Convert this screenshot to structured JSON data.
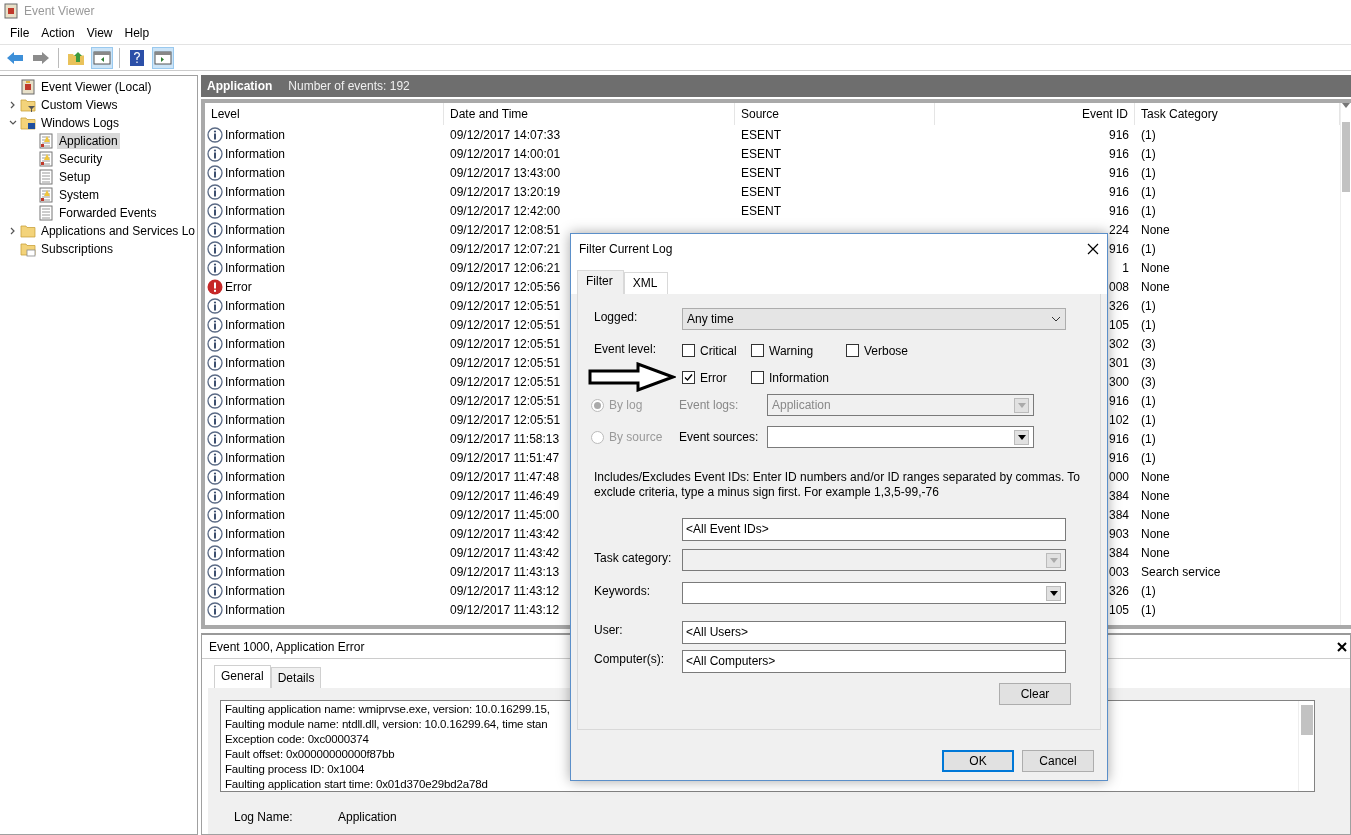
{
  "window": {
    "title": "Event Viewer"
  },
  "menu": [
    "File",
    "Action",
    "View",
    "Help"
  ],
  "tree": [
    {
      "label": "Event Viewer (Local)",
      "kind": "root"
    },
    {
      "label": "Custom Views",
      "kind": "filter-folder",
      "expanded": false
    },
    {
      "label": "Windows Logs",
      "kind": "log-folder",
      "expanded": true,
      "children": [
        {
          "label": "Application",
          "kind": "log",
          "selected": true
        },
        {
          "label": "Security",
          "kind": "log",
          "selected": false
        },
        {
          "label": "Setup",
          "kind": "plain-log",
          "selected": false
        },
        {
          "label": "System",
          "kind": "log",
          "selected": false
        },
        {
          "label": "Forwarded Events",
          "kind": "plain-log",
          "selected": false
        }
      ]
    },
    {
      "label": "Applications and Services Lo",
      "kind": "folder",
      "expanded": false
    },
    {
      "label": "Subscriptions",
      "kind": "subscriptions"
    }
  ],
  "log_pane": {
    "title": "Application",
    "count": "Number of events: 192",
    "columns": [
      "Level",
      "Date and Time",
      "Source",
      "Event ID",
      "Task Category"
    ],
    "rows": [
      {
        "kind": "information",
        "level": "Information",
        "date": "09/12/2017 14:07:33",
        "source": "ESENT",
        "event_id": "916",
        "task_category": "(1)"
      },
      {
        "kind": "information",
        "level": "Information",
        "date": "09/12/2017 14:00:01",
        "source": "ESENT",
        "event_id": "916",
        "task_category": "(1)"
      },
      {
        "kind": "information",
        "level": "Information",
        "date": "09/12/2017 13:43:00",
        "source": "ESENT",
        "event_id": "916",
        "task_category": "(1)"
      },
      {
        "kind": "information",
        "level": "Information",
        "date": "09/12/2017 13:20:19",
        "source": "ESENT",
        "event_id": "916",
        "task_category": "(1)"
      },
      {
        "kind": "information",
        "level": "Information",
        "date": "09/12/2017 12:42:00",
        "source": "ESENT",
        "event_id": "916",
        "task_category": "(1)"
      },
      {
        "kind": "information",
        "level": "Information",
        "date": "09/12/2017 12:08:51",
        "event_id": "224",
        "task_category": "None"
      },
      {
        "kind": "information",
        "level": "Information",
        "date": "09/12/2017 12:07:21",
        "event_id": "916",
        "task_category": "(1)"
      },
      {
        "kind": "information",
        "level": "Information",
        "date": "09/12/2017 12:06:21",
        "event_id": "1",
        "task_category": "None"
      },
      {
        "kind": "error",
        "level": "Error",
        "date": "09/12/2017 12:05:56",
        "event_id": "008",
        "task_category": "None"
      },
      {
        "kind": "information",
        "level": "Information",
        "date": "09/12/2017 12:05:51",
        "event_id": "326",
        "task_category": "(1)"
      },
      {
        "kind": "information",
        "level": "Information",
        "date": "09/12/2017 12:05:51",
        "event_id": "105",
        "task_category": "(1)"
      },
      {
        "kind": "information",
        "level": "Information",
        "date": "09/12/2017 12:05:51",
        "event_id": "302",
        "task_category": "(3)"
      },
      {
        "kind": "information",
        "level": "Information",
        "date": "09/12/2017 12:05:51",
        "event_id": "301",
        "task_category": "(3)"
      },
      {
        "kind": "information",
        "level": "Information",
        "date": "09/12/2017 12:05:51",
        "event_id": "300",
        "task_category": "(3)"
      },
      {
        "kind": "information",
        "level": "Information",
        "date": "09/12/2017 12:05:51",
        "event_id": "916",
        "task_category": "(1)"
      },
      {
        "kind": "information",
        "level": "Information",
        "date": "09/12/2017 12:05:51",
        "event_id": "102",
        "task_category": "(1)"
      },
      {
        "kind": "information",
        "level": "Information",
        "date": "09/12/2017 11:58:13",
        "event_id": "916",
        "task_category": "(1)"
      },
      {
        "kind": "information",
        "level": "Information",
        "date": "09/12/2017 11:51:47",
        "event_id": "916",
        "task_category": "(1)"
      },
      {
        "kind": "information",
        "level": "Information",
        "date": "09/12/2017 11:47:48",
        "event_id": "000",
        "task_category": "None"
      },
      {
        "kind": "information",
        "level": "Information",
        "date": "09/12/2017 11:46:49",
        "event_id": "384",
        "task_category": "None"
      },
      {
        "kind": "information",
        "level": "Information",
        "date": "09/12/2017 11:45:00",
        "event_id": "384",
        "task_category": "None"
      },
      {
        "kind": "information",
        "level": "Information",
        "date": "09/12/2017 11:43:42",
        "event_id": "903",
        "task_category": "None"
      },
      {
        "kind": "information",
        "level": "Information",
        "date": "09/12/2017 11:43:42",
        "event_id": "384",
        "task_category": "None"
      },
      {
        "kind": "information",
        "level": "Information",
        "date": "09/12/2017 11:43:13",
        "event_id": "003",
        "task_category": "Search service"
      },
      {
        "kind": "information",
        "level": "Information",
        "date": "09/12/2017 11:43:12",
        "event_id": "326",
        "task_category": "(1)"
      },
      {
        "kind": "information",
        "level": "Information",
        "date": "09/12/2017 11:43:12",
        "event_id": "105",
        "task_category": "(1)"
      }
    ]
  },
  "details": {
    "title": "Event 1000, Application Error",
    "tabs": [
      {
        "label": "General",
        "selected": true
      },
      {
        "label": "Details",
        "selected": false
      }
    ],
    "description": [
      "Faulting application name: wmiprvse.exe, version: 10.0.16299.15,",
      "Faulting module name: ntdll.dll, version: 10.0.16299.64, time stan",
      "Exception code: 0xc0000374",
      "Fault offset: 0x00000000000f87bb",
      "Faulting process ID: 0x1004",
      "Faulting application start time: 0x01d370e29bd2a78d"
    ],
    "fields": [
      {
        "label": "Log Name:",
        "value": "Application"
      }
    ]
  },
  "dialog": {
    "title": "Filter Current Log",
    "tabs": [
      {
        "label": "Filter",
        "selected": true
      },
      {
        "label": "XML",
        "selected": false
      }
    ],
    "logged": {
      "label": "Logged:",
      "value": "Any time"
    },
    "event_level": {
      "label": "Event level:",
      "options": [
        {
          "label": "Critical",
          "checked": false
        },
        {
          "label": "Warning",
          "checked": false
        },
        {
          "label": "Verbose",
          "checked": false
        },
        {
          "label": "Error",
          "checked": true
        },
        {
          "label": "Information",
          "checked": false
        }
      ]
    },
    "scope": [
      {
        "label": "By log",
        "selected": true,
        "disabled": true
      },
      {
        "label": "By source",
        "selected": false,
        "disabled": true
      }
    ],
    "event_logs": {
      "label": "Event logs:",
      "value": "Application",
      "disabled": true
    },
    "event_sources": {
      "label": "Event sources:",
      "disabled": false
    },
    "help": "Includes/Excludes Event IDs: Enter ID numbers and/or ID ranges separated by commas. To exclude criteria, type a minus sign first. For example 1,3,5-99,-76",
    "event_ids": {
      "value": "<All Event IDs>"
    },
    "task_category": {
      "label": "Task category:",
      "disabled": true
    },
    "keywords": {
      "label": "Keywords:",
      "disabled": false
    },
    "user": {
      "label": "User:",
      "value": "<All Users>"
    },
    "computers": {
      "label": "Computer(s):",
      "value": "<All Computers>"
    },
    "clear": "Clear",
    "ok": "OK",
    "cancel": "Cancel"
  }
}
